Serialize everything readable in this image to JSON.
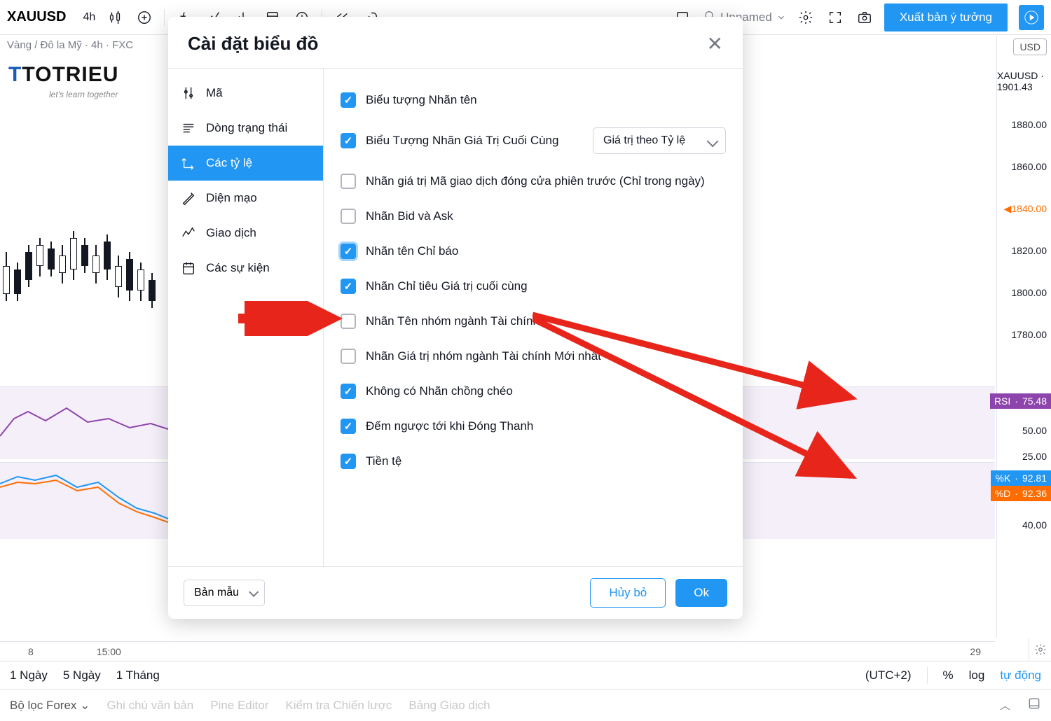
{
  "toolbar": {
    "symbol": "XAUUSD",
    "timeframe": "4h",
    "unnamed": "Unnamed",
    "publish": "Xuất bản ý tưởng"
  },
  "legend": "Vàng / Đô la Mỹ · 4h · FXC",
  "logo_main": "TOTRIEU",
  "logo_sub": "let's learn together",
  "usd_badge": "USD",
  "price_axis": {
    "symbol": "XAUUSD",
    "current": "1901.43",
    "ticks": [
      "1880.00",
      "1860.00",
      "1840.00",
      "1820.00",
      "1800.00",
      "1780.00"
    ],
    "rsi_label": "RSI",
    "rsi_val": "75.48",
    "rsi_50": "50.00",
    "rsi_25": "25.00",
    "k_label": "%K",
    "k_val": "92.81",
    "d_label": "%D",
    "d_val": "92.36",
    "stoch_40": "40.00"
  },
  "time_axis": {
    "t1": "8",
    "t2": "15:00",
    "t3": "29"
  },
  "modal": {
    "title": "Cài đặt biểu đồ",
    "sidebar": [
      "Mã",
      "Dòng trạng thái",
      "Các tỷ lệ",
      "Diện mạo",
      "Giao dịch",
      "Các sự kiện"
    ],
    "options": [
      {
        "label": "Biểu tượng Nhãn tên",
        "checked": true
      },
      {
        "label": "Biểu Tượng Nhãn Giá Trị Cuối Cùng",
        "checked": true,
        "select": "Giá trị theo Tỷ lệ"
      },
      {
        "label": "Nhãn giá trị Mã giao dịch đóng cửa phiên trước (Chỉ trong ngày)",
        "checked": false
      },
      {
        "label": "Nhãn Bid và Ask",
        "checked": false
      },
      {
        "label": "Nhãn tên Chỉ báo",
        "checked": true,
        "highlight": true
      },
      {
        "label": "Nhãn Chỉ tiêu Giá trị cuối cùng",
        "checked": true
      },
      {
        "label": "Nhãn Tên nhóm ngành Tài chính",
        "checked": false
      },
      {
        "label": "Nhãn Giá trị nhóm ngành Tài chính Mới nhất",
        "checked": false
      },
      {
        "label": "Không có Nhãn chồng chéo",
        "checked": true
      },
      {
        "label": "Đếm ngược tới khi Đóng Thanh",
        "checked": true
      },
      {
        "label": "Tiền tệ",
        "checked": true
      }
    ],
    "template": "Bản mẫu",
    "cancel": "Hủy bỏ",
    "ok": "Ok"
  },
  "footer1": {
    "d1": "1 Ngày",
    "d5": "5 Ngày",
    "m1": "1 Tháng",
    "tz": "(UTC+2)",
    "pct": "%",
    "log": "log",
    "auto": "tự động"
  },
  "footer2": {
    "forex": "Bộ lọc Forex",
    "note": "Ghi chú văn bản",
    "pine": "Pine Editor",
    "test": "Kiểm tra Chiến lược",
    "board": "Bảng Giao dịch"
  },
  "watermark": "let's learn together"
}
